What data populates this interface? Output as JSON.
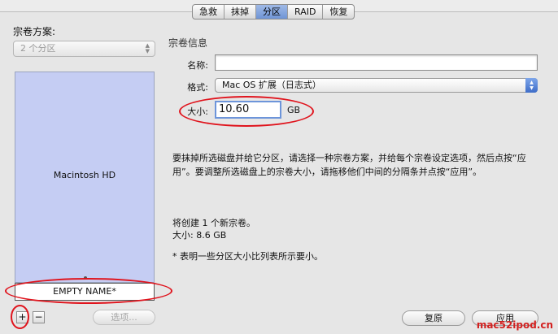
{
  "tabs": [
    "急救",
    "抹掉",
    "分区",
    "RAID",
    "恢复"
  ],
  "active_tab": "分区",
  "left": {
    "title": "宗卷方案:",
    "scheme_value": "2 个分区",
    "partitions": [
      "Macintosh HD",
      "EMPTY NAME*"
    ],
    "add_label": "+",
    "remove_label": "−",
    "options_label": "选项..."
  },
  "right": {
    "title": "宗卷信息",
    "name_label": "名称:",
    "name_value": "",
    "format_label": "格式:",
    "format_value": "Mac OS 扩展（日志式）",
    "size_label": "大小:",
    "size_value": "10.60",
    "size_unit": "GB",
    "info_line1": "要抹掉所选磁盘并给它分区，请选择一种宗卷方案，并给每个宗卷设定选项，然后点按“应",
    "info_line2": "用”。要调整所选磁盘上的宗卷大小，请拖移他们中间的分隔条并点按“应用”。",
    "create_line": "将创建 1 个新宗卷。",
    "create_size": "大小:  8.6 GB",
    "note": "* 表明一些分区大小比列表所示要小。",
    "revert_label": "复原",
    "apply_label": "应用"
  },
  "watermark": "mac52ipod.cn",
  "accent_red": "#e0141d"
}
